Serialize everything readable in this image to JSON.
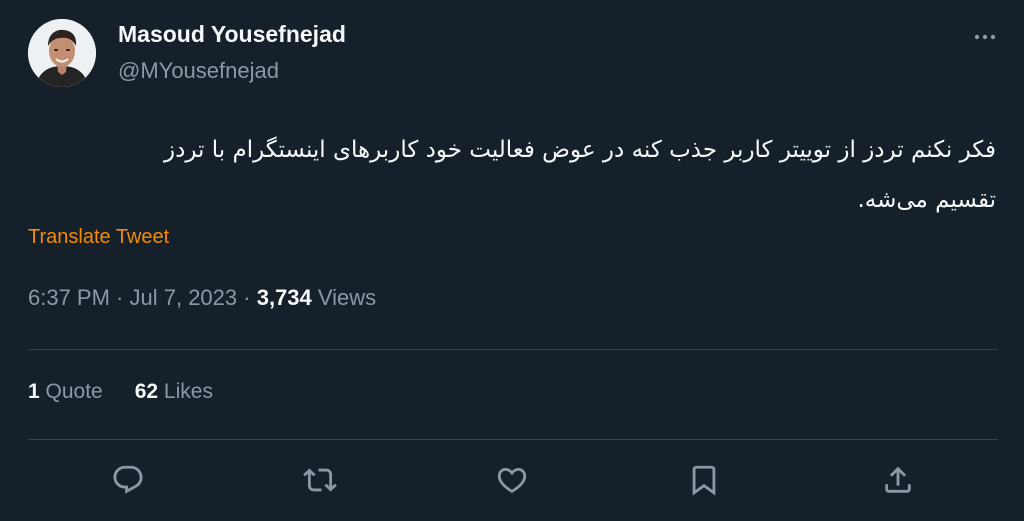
{
  "author": {
    "display_name": "Masoud Yousefnejad",
    "handle": "@MYousefnejad"
  },
  "tweet": {
    "text_line_1": "فکر نکنم تردز از توییتر کاربر جذب کنه در عوض فعالیت خود کاربرهای اینستگرام با تردز",
    "text_line_2": "تقسیم می‌شه.",
    "translate_label": "Translate Tweet",
    "time": "6:37 PM",
    "separator_1": " · ",
    "date": "Jul 7, 2023",
    "separator_2": " · ",
    "views_count": "3,734",
    "views_label": " Views"
  },
  "stats": {
    "quotes_count": "1",
    "quotes_label": " Quote",
    "likes_count": "62",
    "likes_label": " Likes"
  },
  "colors": {
    "background": "#15202b",
    "primary_text": "#f7f9f9",
    "secondary_text": "#8b98a5",
    "accent": "#f58a07",
    "divider": "#38444d"
  },
  "icons": {
    "more": "more-horizontal-icon",
    "reply": "reply-icon",
    "retweet": "retweet-icon",
    "like": "heart-icon",
    "bookmark": "bookmark-icon",
    "share": "share-icon"
  }
}
